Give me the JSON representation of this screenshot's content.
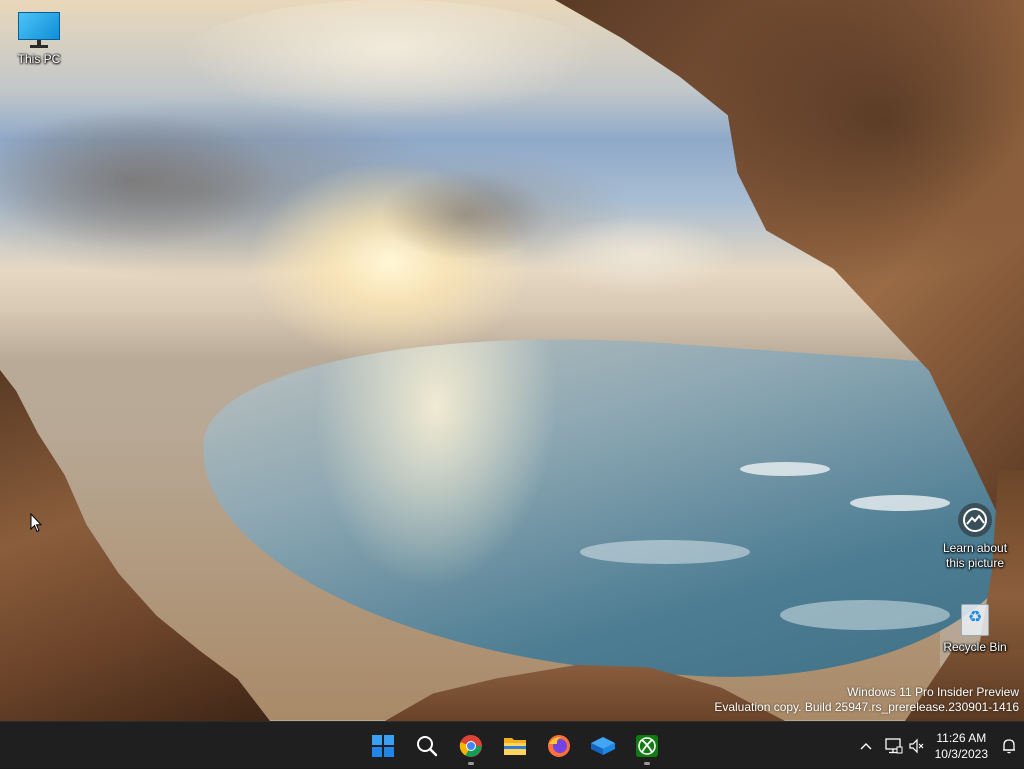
{
  "desktop": {
    "icons": [
      {
        "label": "This PC",
        "icon": "this-pc-icon"
      },
      {
        "label": "Learn about this picture",
        "icon": "learn-picture-icon"
      },
      {
        "label": "Recycle Bin",
        "icon": "recycle-bin-icon"
      }
    ],
    "watermark": {
      "line1": "Windows 11 Pro Insider Preview",
      "line2": "Evaluation copy. Build 25947.rs_prerelease.230901-1416"
    }
  },
  "taskbar": {
    "apps": [
      {
        "name": "Start",
        "icon": "windows-start-icon",
        "running": false
      },
      {
        "name": "Search",
        "icon": "search-icon",
        "running": false
      },
      {
        "name": "Google Chrome",
        "icon": "chrome-icon",
        "running": true
      },
      {
        "name": "File Explorer",
        "icon": "file-explorer-icon",
        "running": false
      },
      {
        "name": "Firefox",
        "icon": "firefox-icon",
        "running": false
      },
      {
        "name": "Box Drive",
        "icon": "box-app-icon",
        "running": false
      },
      {
        "name": "Xbox",
        "icon": "xbox-icon",
        "running": true
      }
    ],
    "tray": {
      "time": "11:26 AM",
      "date": "10/3/2023",
      "icons": [
        "chevron-up-icon",
        "network-icon",
        "volume-muted-icon",
        "notification-bell-icon"
      ]
    }
  },
  "colors": {
    "taskbar_bg": "#1f1f1f",
    "start_blue": "#0078d4",
    "xbox_green": "#107c10"
  }
}
